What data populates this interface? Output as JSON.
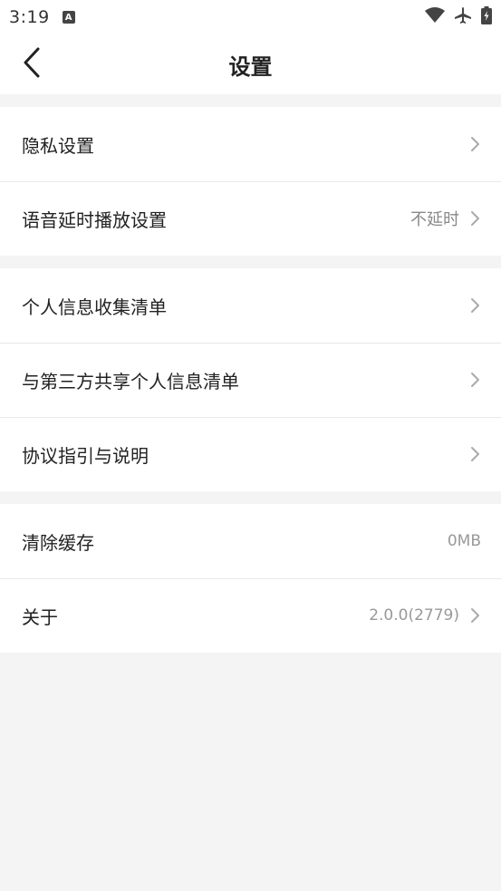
{
  "status": {
    "time": "3:19",
    "notif_icon_letter": "A"
  },
  "header": {
    "title": "设置"
  },
  "groups": [
    {
      "items": [
        {
          "label": "隐私设置",
          "value": ""
        },
        {
          "label": "语音延时播放设置",
          "value": "不延时"
        }
      ]
    },
    {
      "items": [
        {
          "label": "个人信息收集清单",
          "value": ""
        },
        {
          "label": "与第三方共享个人信息清单",
          "value": ""
        },
        {
          "label": "协议指引与说明",
          "value": ""
        }
      ]
    },
    {
      "items": [
        {
          "label": "清除缓存",
          "value": "0MB"
        },
        {
          "label": "关于",
          "value": "2.0.0(2779)"
        }
      ]
    }
  ],
  "icons": {
    "back": "back-arrow-icon",
    "chevron": "chevron-right-icon",
    "wifi": "wifi-icon",
    "airplane": "airplane-icon",
    "battery": "battery-charging-icon"
  },
  "colors": {
    "background": "#f4f4f4",
    "card": "#ffffff",
    "text": "#222222",
    "secondary_text": "#888888",
    "chevron": "#aaaaaa"
  }
}
